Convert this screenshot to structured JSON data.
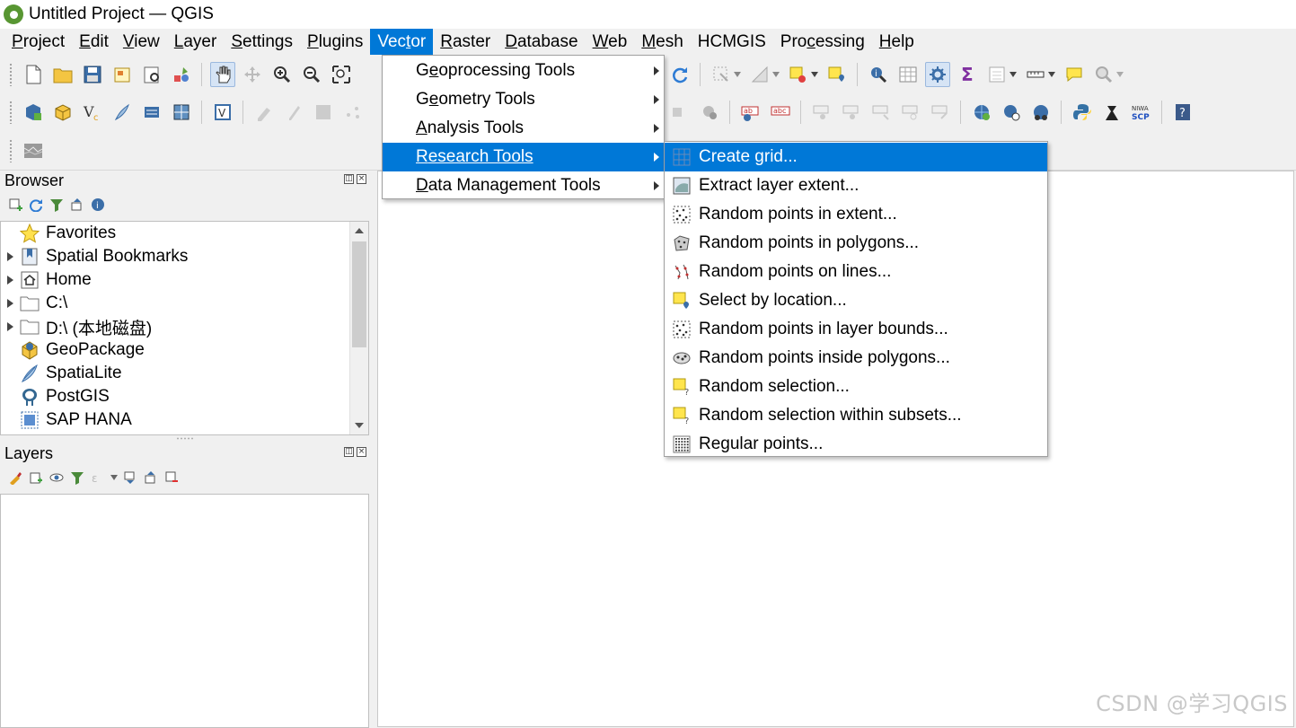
{
  "window": {
    "title": "Untitled Project — QGIS"
  },
  "menubar": {
    "items": [
      {
        "label": "Project",
        "key": "P",
        "rest": "roject"
      },
      {
        "label": "Edit",
        "key": "E",
        "rest": "dit"
      },
      {
        "label": "View",
        "key": "V",
        "rest": "iew"
      },
      {
        "label": "Layer",
        "key": "L",
        "rest": "ayer"
      },
      {
        "label": "Settings",
        "key": "S",
        "rest": "ettings"
      },
      {
        "label": "Plugins",
        "key": "P",
        "rest": "lugins"
      },
      {
        "label": "Vector",
        "pre": "Vec",
        "key": "t",
        "rest": "or"
      },
      {
        "label": "Raster",
        "key": "R",
        "rest": "aster"
      },
      {
        "label": "Database",
        "key": "D",
        "rest": "atabase"
      },
      {
        "label": "Web",
        "key": "W",
        "rest": "eb"
      },
      {
        "label": "Mesh",
        "key": "M",
        "rest": "esh"
      },
      {
        "label": "HCMGIS",
        "pre": "HCMGIS",
        "key": "",
        "rest": ""
      },
      {
        "label": "Processing",
        "pre": "Pro",
        "key": "c",
        "rest": "essing"
      },
      {
        "label": "Help",
        "key": "H",
        "rest": "elp"
      }
    ]
  },
  "vector_menu": {
    "items": [
      {
        "pre": "G",
        "key": "e",
        "rest": "oprocessing Tools"
      },
      {
        "pre": "G",
        "key": "e",
        "rest": "ometry Tools"
      },
      {
        "pre": "",
        "key": "A",
        "rest": "nalysis Tools"
      },
      {
        "pre": "",
        "key": "R",
        "rest": "esearch Tools"
      },
      {
        "pre": "",
        "key": "D",
        "rest": "ata Management Tools"
      }
    ]
  },
  "research_tools_menu": {
    "items": [
      {
        "label": "Create grid...",
        "icon": "grid-icon"
      },
      {
        "label": "Extract layer extent...",
        "icon": "extent-icon"
      },
      {
        "label": "Random points in extent...",
        "icon": "random-points-icon"
      },
      {
        "label": "Random points in polygons...",
        "icon": "random-points-polygon-icon"
      },
      {
        "label": "Random points on lines...",
        "icon": "random-points-lines-icon"
      },
      {
        "label": "Select by location...",
        "icon": "select-location-icon"
      },
      {
        "label": "Random points in layer bounds...",
        "icon": "random-points-icon"
      },
      {
        "label": "Random points inside polygons...",
        "icon": "random-points-inside-icon"
      },
      {
        "label": "Random selection...",
        "icon": "random-selection-icon"
      },
      {
        "label": "Random selection within subsets...",
        "icon": "random-selection-icon"
      },
      {
        "label": "Regular points...",
        "icon": "regular-points-icon"
      }
    ]
  },
  "browser_panel": {
    "title": "Browser",
    "items": [
      {
        "label": "Favorites",
        "icon": "star-icon",
        "expandable": false
      },
      {
        "label": "Spatial Bookmarks",
        "icon": "bookmark-icon",
        "expandable": true
      },
      {
        "label": "Home",
        "icon": "home-icon",
        "expandable": true
      },
      {
        "label": "C:\\",
        "icon": "folder-icon",
        "expandable": true
      },
      {
        "label": "D:\\ (本地磁盘)",
        "icon": "folder-icon",
        "expandable": true
      },
      {
        "label": "GeoPackage",
        "icon": "geopackage-icon",
        "expandable": false
      },
      {
        "label": "SpatiaLite",
        "icon": "spatialite-icon",
        "expandable": false
      },
      {
        "label": "PostGIS",
        "icon": "postgis-icon",
        "expandable": false
      },
      {
        "label": "SAP HANA",
        "icon": "sap-hana-icon",
        "expandable": false
      }
    ]
  },
  "layers_panel": {
    "title": "Layers"
  },
  "watermark": "CSDN @学习QGIS",
  "colors": {
    "accent": "#0078d7",
    "qgis_green": "#589632"
  }
}
